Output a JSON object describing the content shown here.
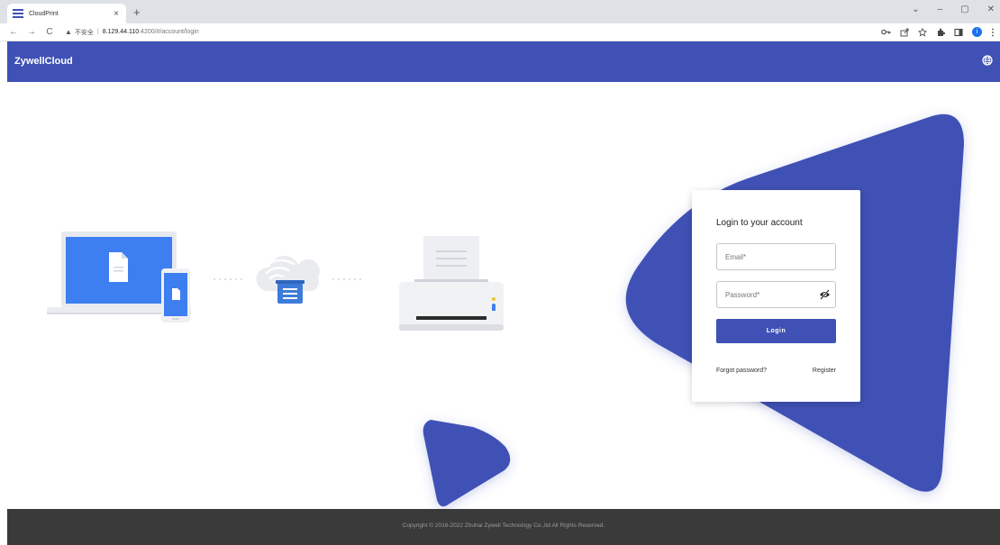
{
  "browser": {
    "tab_title": "CloudPrint",
    "tab_close": "×",
    "new_tab": "+",
    "nav": {
      "back": "←",
      "forward": "→",
      "reload": "C"
    },
    "insecure_label": "不安全",
    "url_host": "8.129.44.110",
    "url_rest": ":4200/#/account/login",
    "window_controls": {
      "dropdown": "⌄",
      "minimize": "–",
      "restore": "▢",
      "close": "✕"
    },
    "toolbar_icons": [
      "key-icon",
      "share-icon",
      "star-icon",
      "extensions-icon",
      "sidebar-icon",
      "profile-avatar",
      "menu-icon"
    ],
    "profile_initial": "i"
  },
  "app": {
    "brand": "ZywellCloud",
    "language_icon": "globe-icon",
    "accent": "#3f51b5"
  },
  "login": {
    "title": "Login to your account",
    "email_placeholder": "Email*",
    "password_placeholder": "Password*",
    "visibility_icon": "eye-off-icon",
    "button_label": "Login",
    "forgot_password": "Forgot password?",
    "register": "Register"
  },
  "illustration": {
    "icons": [
      "laptop-icon",
      "phone-icon",
      "document-icon",
      "cloud-icon",
      "wifi-icon",
      "printer-icon"
    ]
  },
  "footer": {
    "copyright": "Copyright © 2016-2022 Zhuhai Zywell Technology Co.,ltd All Rights Reserved."
  }
}
